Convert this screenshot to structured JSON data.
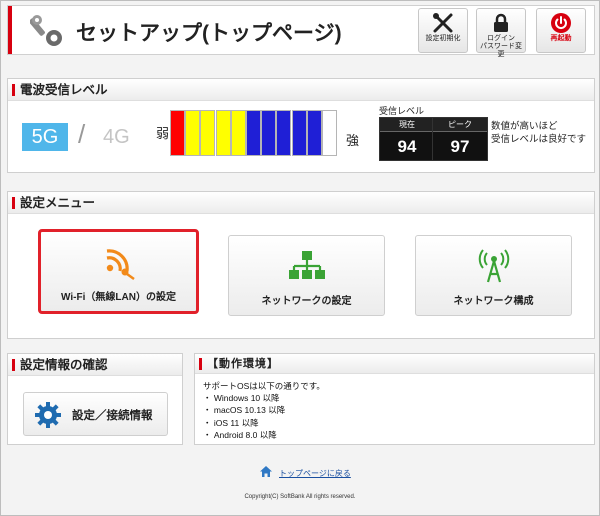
{
  "header": {
    "title": "セットアップ(トップページ)",
    "buttons": [
      {
        "label": "設定初期化",
        "icon": "tools-icon"
      },
      {
        "label_line1": "ログイン",
        "label_line2": "パスワード変更",
        "icon": "lock-icon"
      },
      {
        "label": "再起動",
        "icon": "power-icon"
      }
    ]
  },
  "signal": {
    "heading": "電波受信レベル",
    "band_active": "5G",
    "band_separator": "/",
    "band_inactive": "4G",
    "weak_label": "弱",
    "strong_label": "強",
    "bars": [
      "#ff0000",
      "#ffff00",
      "#ffff00",
      "#ffff00",
      "#ffff00",
      "#1f1fd6",
      "#1f1fd6",
      "#1f1fd6",
      "#1f1fd6",
      "#1f1fd6",
      "#ffffff"
    ],
    "level_title": "受信レベル",
    "current_label": "現在",
    "current_value": "94",
    "peak_label": "ピーク",
    "peak_value": "97",
    "note_line1": "数値が高いほど",
    "note_line2": "受信レベルは良好です"
  },
  "menu": {
    "heading": "設定メニュー",
    "items": [
      {
        "label": "Wi-Fi（無線LAN）の設定",
        "icon": "wifi-key-icon",
        "selected": true
      },
      {
        "label": "ネットワークの設定",
        "icon": "network-tree-icon",
        "selected": false
      },
      {
        "label": "ネットワーク構成",
        "icon": "antenna-icon",
        "selected": false
      }
    ]
  },
  "info": {
    "heading": "設定情報の確認",
    "button_label": "設定／接続情報"
  },
  "env": {
    "heading": "【動作環境】",
    "intro": "サポートOSは以下の通りです。",
    "items": [
      "・ Windows 10 以降",
      "・ macOS 10.13 以降",
      "・ iOS 11 以降",
      "・ Android 8.0 以降"
    ]
  },
  "footer": {
    "top_link": "トップページに戻る",
    "copyright": "Copyright(C) SoftBank All rights reserved."
  },
  "colors": {
    "accent_red": "#d7000f",
    "band_blue": "#4fb6ea",
    "icon_orange": "#f28a1a",
    "icon_green": "#3aa335",
    "gear_blue": "#1f6bb0"
  }
}
